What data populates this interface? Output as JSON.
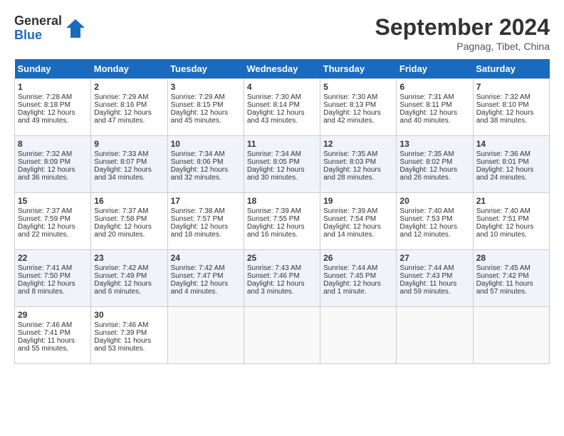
{
  "header": {
    "logo_general": "General",
    "logo_blue": "Blue",
    "month_title": "September 2024",
    "location": "Pagnag, Tibet, China"
  },
  "weekdays": [
    "Sunday",
    "Monday",
    "Tuesday",
    "Wednesday",
    "Thursday",
    "Friday",
    "Saturday"
  ],
  "weeks": [
    [
      {
        "day": "1",
        "lines": [
          "Sunrise: 7:28 AM",
          "Sunset: 8:18 PM",
          "Daylight: 12 hours",
          "and 49 minutes."
        ]
      },
      {
        "day": "2",
        "lines": [
          "Sunrise: 7:29 AM",
          "Sunset: 8:16 PM",
          "Daylight: 12 hours",
          "and 47 minutes."
        ]
      },
      {
        "day": "3",
        "lines": [
          "Sunrise: 7:29 AM",
          "Sunset: 8:15 PM",
          "Daylight: 12 hours",
          "and 45 minutes."
        ]
      },
      {
        "day": "4",
        "lines": [
          "Sunrise: 7:30 AM",
          "Sunset: 8:14 PM",
          "Daylight: 12 hours",
          "and 43 minutes."
        ]
      },
      {
        "day": "5",
        "lines": [
          "Sunrise: 7:30 AM",
          "Sunset: 8:13 PM",
          "Daylight: 12 hours",
          "and 42 minutes."
        ]
      },
      {
        "day": "6",
        "lines": [
          "Sunrise: 7:31 AM",
          "Sunset: 8:11 PM",
          "Daylight: 12 hours",
          "and 40 minutes."
        ]
      },
      {
        "day": "7",
        "lines": [
          "Sunrise: 7:32 AM",
          "Sunset: 8:10 PM",
          "Daylight: 12 hours",
          "and 38 minutes."
        ]
      }
    ],
    [
      {
        "day": "8",
        "lines": [
          "Sunrise: 7:32 AM",
          "Sunset: 8:09 PM",
          "Daylight: 12 hours",
          "and 36 minutes."
        ]
      },
      {
        "day": "9",
        "lines": [
          "Sunrise: 7:33 AM",
          "Sunset: 8:07 PM",
          "Daylight: 12 hours",
          "and 34 minutes."
        ]
      },
      {
        "day": "10",
        "lines": [
          "Sunrise: 7:34 AM",
          "Sunset: 8:06 PM",
          "Daylight: 12 hours",
          "and 32 minutes."
        ]
      },
      {
        "day": "11",
        "lines": [
          "Sunrise: 7:34 AM",
          "Sunset: 8:05 PM",
          "Daylight: 12 hours",
          "and 30 minutes."
        ]
      },
      {
        "day": "12",
        "lines": [
          "Sunrise: 7:35 AM",
          "Sunset: 8:03 PM",
          "Daylight: 12 hours",
          "and 28 minutes."
        ]
      },
      {
        "day": "13",
        "lines": [
          "Sunrise: 7:35 AM",
          "Sunset: 8:02 PM",
          "Daylight: 12 hours",
          "and 26 minutes."
        ]
      },
      {
        "day": "14",
        "lines": [
          "Sunrise: 7:36 AM",
          "Sunset: 8:01 PM",
          "Daylight: 12 hours",
          "and 24 minutes."
        ]
      }
    ],
    [
      {
        "day": "15",
        "lines": [
          "Sunrise: 7:37 AM",
          "Sunset: 7:59 PM",
          "Daylight: 12 hours",
          "and 22 minutes."
        ]
      },
      {
        "day": "16",
        "lines": [
          "Sunrise: 7:37 AM",
          "Sunset: 7:58 PM",
          "Daylight: 12 hours",
          "and 20 minutes."
        ]
      },
      {
        "day": "17",
        "lines": [
          "Sunrise: 7:38 AM",
          "Sunset: 7:57 PM",
          "Daylight: 12 hours",
          "and 18 minutes."
        ]
      },
      {
        "day": "18",
        "lines": [
          "Sunrise: 7:39 AM",
          "Sunset: 7:55 PM",
          "Daylight: 12 hours",
          "and 16 minutes."
        ]
      },
      {
        "day": "19",
        "lines": [
          "Sunrise: 7:39 AM",
          "Sunset: 7:54 PM",
          "Daylight: 12 hours",
          "and 14 minutes."
        ]
      },
      {
        "day": "20",
        "lines": [
          "Sunrise: 7:40 AM",
          "Sunset: 7:53 PM",
          "Daylight: 12 hours",
          "and 12 minutes."
        ]
      },
      {
        "day": "21",
        "lines": [
          "Sunrise: 7:40 AM",
          "Sunset: 7:51 PM",
          "Daylight: 12 hours",
          "and 10 minutes."
        ]
      }
    ],
    [
      {
        "day": "22",
        "lines": [
          "Sunrise: 7:41 AM",
          "Sunset: 7:50 PM",
          "Daylight: 12 hours",
          "and 8 minutes."
        ]
      },
      {
        "day": "23",
        "lines": [
          "Sunrise: 7:42 AM",
          "Sunset: 7:49 PM",
          "Daylight: 12 hours",
          "and 6 minutes."
        ]
      },
      {
        "day": "24",
        "lines": [
          "Sunrise: 7:42 AM",
          "Sunset: 7:47 PM",
          "Daylight: 12 hours",
          "and 4 minutes."
        ]
      },
      {
        "day": "25",
        "lines": [
          "Sunrise: 7:43 AM",
          "Sunset: 7:46 PM",
          "Daylight: 12 hours",
          "and 3 minutes."
        ]
      },
      {
        "day": "26",
        "lines": [
          "Sunrise: 7:44 AM",
          "Sunset: 7:45 PM",
          "Daylight: 12 hours",
          "and 1 minute."
        ]
      },
      {
        "day": "27",
        "lines": [
          "Sunrise: 7:44 AM",
          "Sunset: 7:43 PM",
          "Daylight: 11 hours",
          "and 59 minutes."
        ]
      },
      {
        "day": "28",
        "lines": [
          "Sunrise: 7:45 AM",
          "Sunset: 7:42 PM",
          "Daylight: 11 hours",
          "and 57 minutes."
        ]
      }
    ],
    [
      {
        "day": "29",
        "lines": [
          "Sunrise: 7:46 AM",
          "Sunset: 7:41 PM",
          "Daylight: 11 hours",
          "and 55 minutes."
        ]
      },
      {
        "day": "30",
        "lines": [
          "Sunrise: 7:46 AM",
          "Sunset: 7:39 PM",
          "Daylight: 11 hours",
          "and 53 minutes."
        ]
      },
      {
        "day": "",
        "lines": []
      },
      {
        "day": "",
        "lines": []
      },
      {
        "day": "",
        "lines": []
      },
      {
        "day": "",
        "lines": []
      },
      {
        "day": "",
        "lines": []
      }
    ]
  ]
}
